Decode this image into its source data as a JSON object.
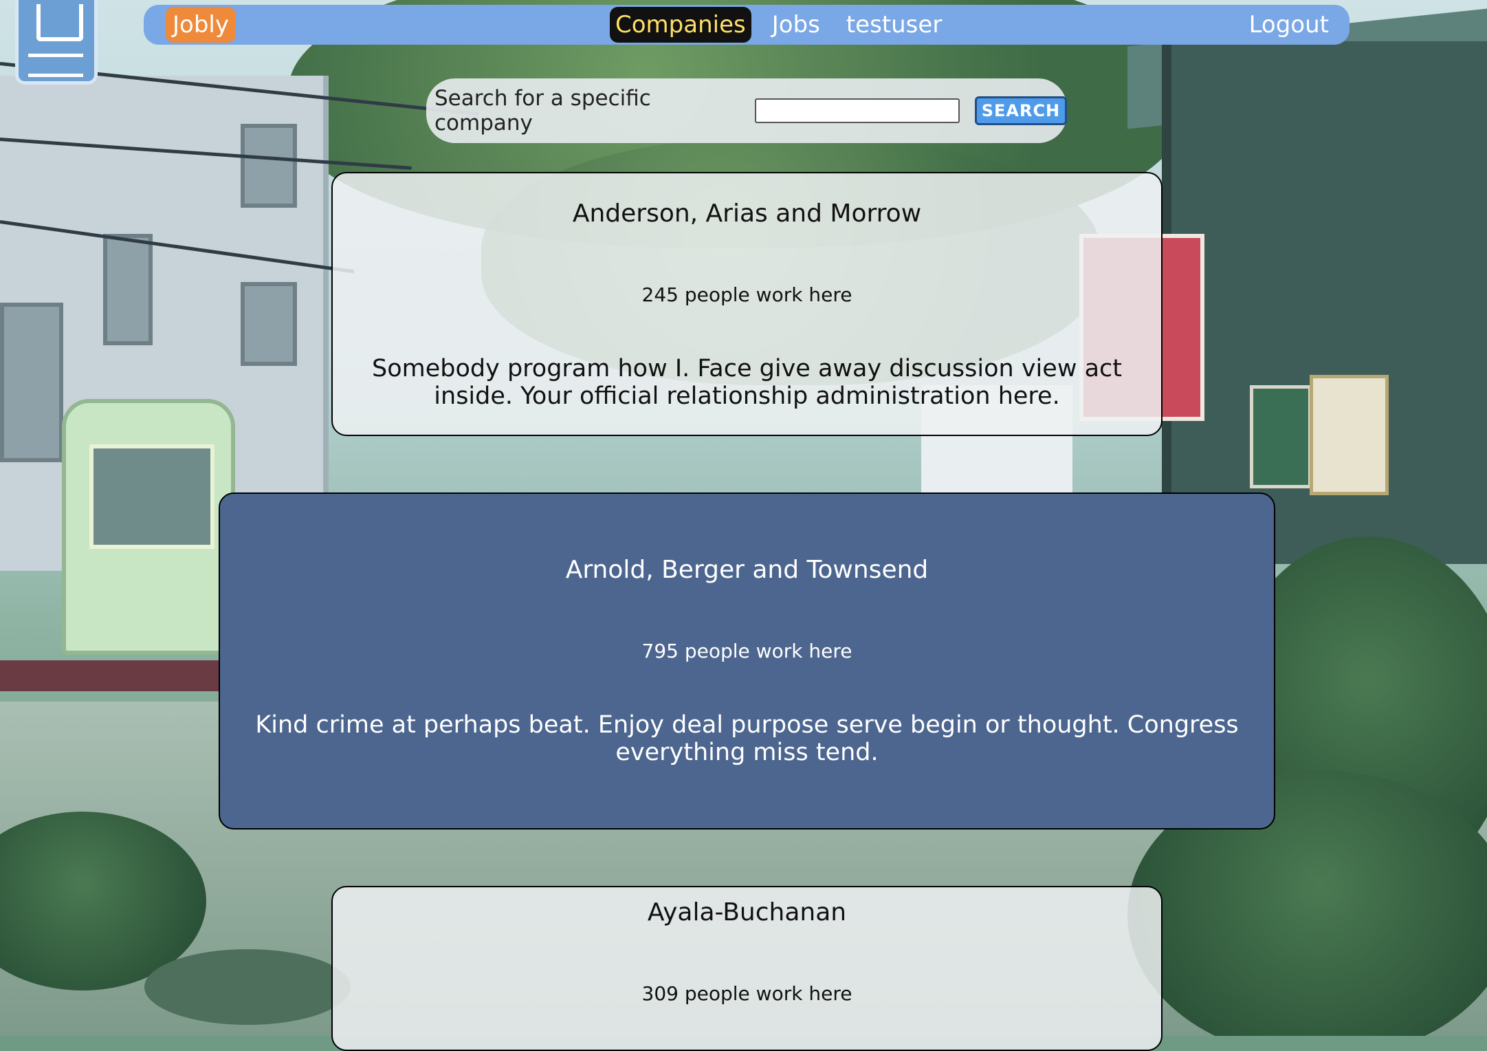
{
  "navbar": {
    "brand": "Jobly",
    "links": [
      {
        "label": "Companies",
        "active": true
      },
      {
        "label": "Jobs",
        "active": false
      },
      {
        "label": "testuser",
        "active": false
      }
    ],
    "logout": "Logout"
  },
  "search": {
    "label": "Search for a specific company",
    "value": "",
    "placeholder": "",
    "button": "SEARCH"
  },
  "companies": [
    {
      "name": "Anderson, Arias and Morrow",
      "employees": "245 people work here",
      "description": "Somebody program how I. Face give away discussion view act inside. Your official relationship administration here.",
      "highlighted": false
    },
    {
      "name": "Arnold, Berger and Townsend",
      "employees": "795 people work here",
      "description": "Kind crime at perhaps beat. Enjoy deal purpose serve begin or thought. Congress everything miss tend.",
      "highlighted": true
    },
    {
      "name": "Ayala-Buchanan",
      "employees": "309 people work here",
      "description": "",
      "highlighted": false
    }
  ],
  "colors": {
    "navbar": "#7aa7e6",
    "brand_bg": "#ee8a3a",
    "active_link_bg": "#111111",
    "active_link_text": "#ffe066",
    "highlight_card": "#4d668f",
    "search_button": "#4f9bea"
  }
}
